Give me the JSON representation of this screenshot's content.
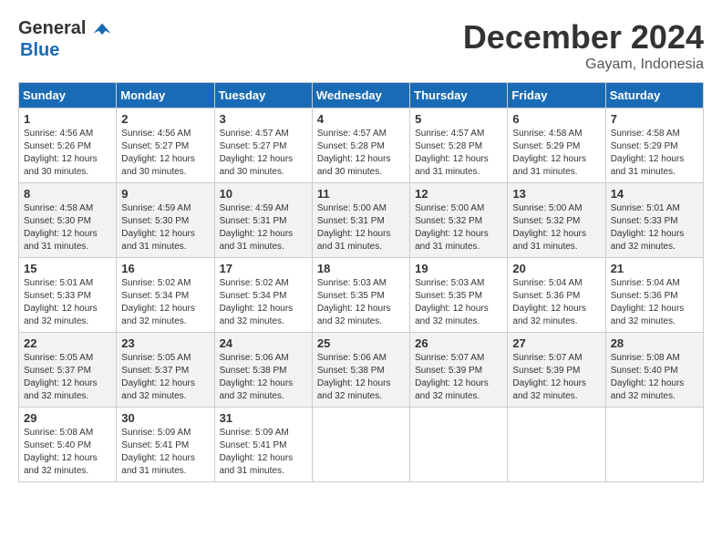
{
  "header": {
    "logo_general": "General",
    "logo_blue": "Blue",
    "month_year": "December 2024",
    "location": "Gayam, Indonesia"
  },
  "days_of_week": [
    "Sunday",
    "Monday",
    "Tuesday",
    "Wednesday",
    "Thursday",
    "Friday",
    "Saturday"
  ],
  "weeks": [
    [
      {
        "day": "1",
        "sunrise": "4:56 AM",
        "sunset": "5:26 PM",
        "daylight": "12 hours and 30 minutes."
      },
      {
        "day": "2",
        "sunrise": "4:56 AM",
        "sunset": "5:27 PM",
        "daylight": "12 hours and 30 minutes."
      },
      {
        "day": "3",
        "sunrise": "4:57 AM",
        "sunset": "5:27 PM",
        "daylight": "12 hours and 30 minutes."
      },
      {
        "day": "4",
        "sunrise": "4:57 AM",
        "sunset": "5:28 PM",
        "daylight": "12 hours and 30 minutes."
      },
      {
        "day": "5",
        "sunrise": "4:57 AM",
        "sunset": "5:28 PM",
        "daylight": "12 hours and 31 minutes."
      },
      {
        "day": "6",
        "sunrise": "4:58 AM",
        "sunset": "5:29 PM",
        "daylight": "12 hours and 31 minutes."
      },
      {
        "day": "7",
        "sunrise": "4:58 AM",
        "sunset": "5:29 PM",
        "daylight": "12 hours and 31 minutes."
      }
    ],
    [
      {
        "day": "8",
        "sunrise": "4:58 AM",
        "sunset": "5:30 PM",
        "daylight": "12 hours and 31 minutes."
      },
      {
        "day": "9",
        "sunrise": "4:59 AM",
        "sunset": "5:30 PM",
        "daylight": "12 hours and 31 minutes."
      },
      {
        "day": "10",
        "sunrise": "4:59 AM",
        "sunset": "5:31 PM",
        "daylight": "12 hours and 31 minutes."
      },
      {
        "day": "11",
        "sunrise": "5:00 AM",
        "sunset": "5:31 PM",
        "daylight": "12 hours and 31 minutes."
      },
      {
        "day": "12",
        "sunrise": "5:00 AM",
        "sunset": "5:32 PM",
        "daylight": "12 hours and 31 minutes."
      },
      {
        "day": "13",
        "sunrise": "5:00 AM",
        "sunset": "5:32 PM",
        "daylight": "12 hours and 31 minutes."
      },
      {
        "day": "14",
        "sunrise": "5:01 AM",
        "sunset": "5:33 PM",
        "daylight": "12 hours and 32 minutes."
      }
    ],
    [
      {
        "day": "15",
        "sunrise": "5:01 AM",
        "sunset": "5:33 PM",
        "daylight": "12 hours and 32 minutes."
      },
      {
        "day": "16",
        "sunrise": "5:02 AM",
        "sunset": "5:34 PM",
        "daylight": "12 hours and 32 minutes."
      },
      {
        "day": "17",
        "sunrise": "5:02 AM",
        "sunset": "5:34 PM",
        "daylight": "12 hours and 32 minutes."
      },
      {
        "day": "18",
        "sunrise": "5:03 AM",
        "sunset": "5:35 PM",
        "daylight": "12 hours and 32 minutes."
      },
      {
        "day": "19",
        "sunrise": "5:03 AM",
        "sunset": "5:35 PM",
        "daylight": "12 hours and 32 minutes."
      },
      {
        "day": "20",
        "sunrise": "5:04 AM",
        "sunset": "5:36 PM",
        "daylight": "12 hours and 32 minutes."
      },
      {
        "day": "21",
        "sunrise": "5:04 AM",
        "sunset": "5:36 PM",
        "daylight": "12 hours and 32 minutes."
      }
    ],
    [
      {
        "day": "22",
        "sunrise": "5:05 AM",
        "sunset": "5:37 PM",
        "daylight": "12 hours and 32 minutes."
      },
      {
        "day": "23",
        "sunrise": "5:05 AM",
        "sunset": "5:37 PM",
        "daylight": "12 hours and 32 minutes."
      },
      {
        "day": "24",
        "sunrise": "5:06 AM",
        "sunset": "5:38 PM",
        "daylight": "12 hours and 32 minutes."
      },
      {
        "day": "25",
        "sunrise": "5:06 AM",
        "sunset": "5:38 PM",
        "daylight": "12 hours and 32 minutes."
      },
      {
        "day": "26",
        "sunrise": "5:07 AM",
        "sunset": "5:39 PM",
        "daylight": "12 hours and 32 minutes."
      },
      {
        "day": "27",
        "sunrise": "5:07 AM",
        "sunset": "5:39 PM",
        "daylight": "12 hours and 32 minutes."
      },
      {
        "day": "28",
        "sunrise": "5:08 AM",
        "sunset": "5:40 PM",
        "daylight": "12 hours and 32 minutes."
      }
    ],
    [
      {
        "day": "29",
        "sunrise": "5:08 AM",
        "sunset": "5:40 PM",
        "daylight": "12 hours and 32 minutes."
      },
      {
        "day": "30",
        "sunrise": "5:09 AM",
        "sunset": "5:41 PM",
        "daylight": "12 hours and 31 minutes."
      },
      {
        "day": "31",
        "sunrise": "5:09 AM",
        "sunset": "5:41 PM",
        "daylight": "12 hours and 31 minutes."
      },
      null,
      null,
      null,
      null
    ]
  ],
  "labels": {
    "sunrise": "Sunrise: ",
    "sunset": "Sunset: ",
    "daylight": "Daylight: "
  }
}
